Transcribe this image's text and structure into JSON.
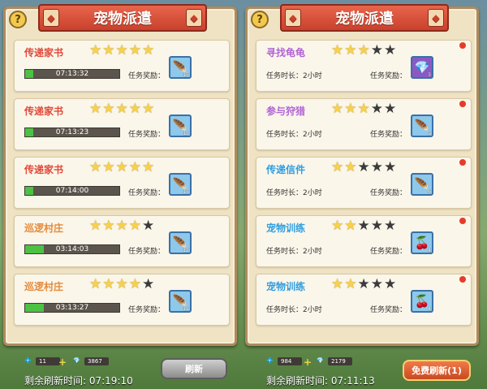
{
  "left_panel": {
    "title": "宠物派遣",
    "help": "?",
    "tasks": [
      {
        "name": "传递家书",
        "stars": 5,
        "timer": "07:13:32",
        "reward_label": "任务奖励：",
        "reward_qty": "15"
      },
      {
        "name": "传递家书",
        "stars": 5,
        "timer": "07:13:23",
        "reward_label": "任务奖励：",
        "reward_qty": "15"
      },
      {
        "name": "传递家书",
        "stars": 5,
        "timer": "07:14:00",
        "reward_label": "任务奖励：",
        "reward_qty": "15"
      },
      {
        "name": "巡逻村庄",
        "stars": 4,
        "timer": "03:14:03",
        "reward_label": "任务奖励：",
        "reward_qty": "12"
      },
      {
        "name": "巡逻村庄",
        "stars": 4,
        "timer": "03:13:27",
        "reward_label": "任务奖励：",
        "reward_qty": "12"
      }
    ],
    "res1": "11",
    "res2": "3867",
    "refresh_button": "刷新",
    "timer_label": "剩余刷新时间: 07:19:10"
  },
  "right_panel": {
    "title": "宠物派遣",
    "help": "?",
    "tasks": [
      {
        "name": "寻找龟龟",
        "stars": 3,
        "duration": "任务时长：2小时",
        "reward_label": "任务奖励：",
        "reward_qty": "3",
        "reward_icon": "crystal-icon"
      },
      {
        "name": "参与狩猎",
        "stars": 3,
        "duration": "任务时长：2小时",
        "reward_label": "任务奖励：",
        "reward_qty": "9",
        "reward_icon": "feather-icon"
      },
      {
        "name": "传递信件",
        "stars": 2,
        "duration": "任务时长：2小时",
        "reward_label": "任务奖励：",
        "reward_qty": "6",
        "reward_icon": "feather-icon"
      },
      {
        "name": "宠物训练",
        "stars": 2,
        "duration": "任务时长：2小时",
        "reward_label": "任务奖励：",
        "reward_qty": "4",
        "reward_icon": "cherry-icon"
      },
      {
        "name": "宠物训练",
        "stars": 2,
        "duration": "任务时长：2小时",
        "reward_label": "任务奖励：",
        "reward_qty": "4",
        "reward_icon": "cherry-icon"
      }
    ],
    "res1": "984",
    "res2": "2179",
    "free_refresh_button": "免费刷新(1)",
    "timer_label": "剩余刷新时间: 07:11:13"
  },
  "colors": {
    "task_red": "#e04a3a",
    "task_orange": "#e48a3a",
    "task_purple": "#b065d6",
    "task_blue": "#2f9ee0",
    "progress_green": "#4cc144"
  }
}
